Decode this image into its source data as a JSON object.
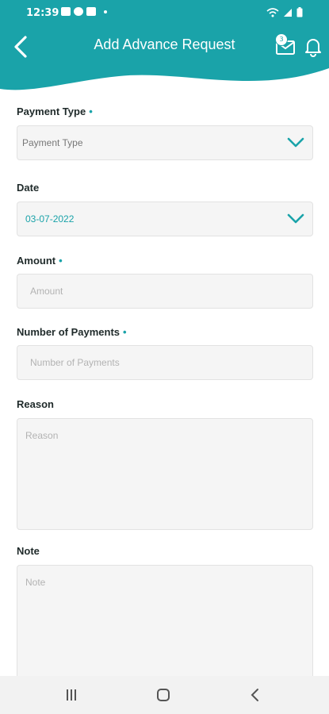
{
  "status_bar": {
    "time": "12:39"
  },
  "header": {
    "title": "Add Advance Request",
    "message_badge": "3"
  },
  "form": {
    "payment_type": {
      "label": "Payment Type",
      "required_mark": "•",
      "value": "Payment Type"
    },
    "date": {
      "label": "Date",
      "value": "03-07-2022"
    },
    "amount": {
      "label": "Amount",
      "required_mark": "•",
      "placeholder": "Amount"
    },
    "number_of_payments": {
      "label": "Number of Payments",
      "required_mark": "•",
      "placeholder": "Number of Payments"
    },
    "reason": {
      "label": "Reason",
      "placeholder": "Reason"
    },
    "note": {
      "label": "Note",
      "placeholder": "Note"
    }
  },
  "colors": {
    "accent": "#1aa3a9",
    "field_bg": "#f5f5f5",
    "nav_bg": "#f2f2f2"
  },
  "icons": [
    "back-arrow-icon",
    "message-icon",
    "bell-icon",
    "chevron-down-icon",
    "recent-apps-icon",
    "home-icon",
    "nav-back-icon"
  ]
}
